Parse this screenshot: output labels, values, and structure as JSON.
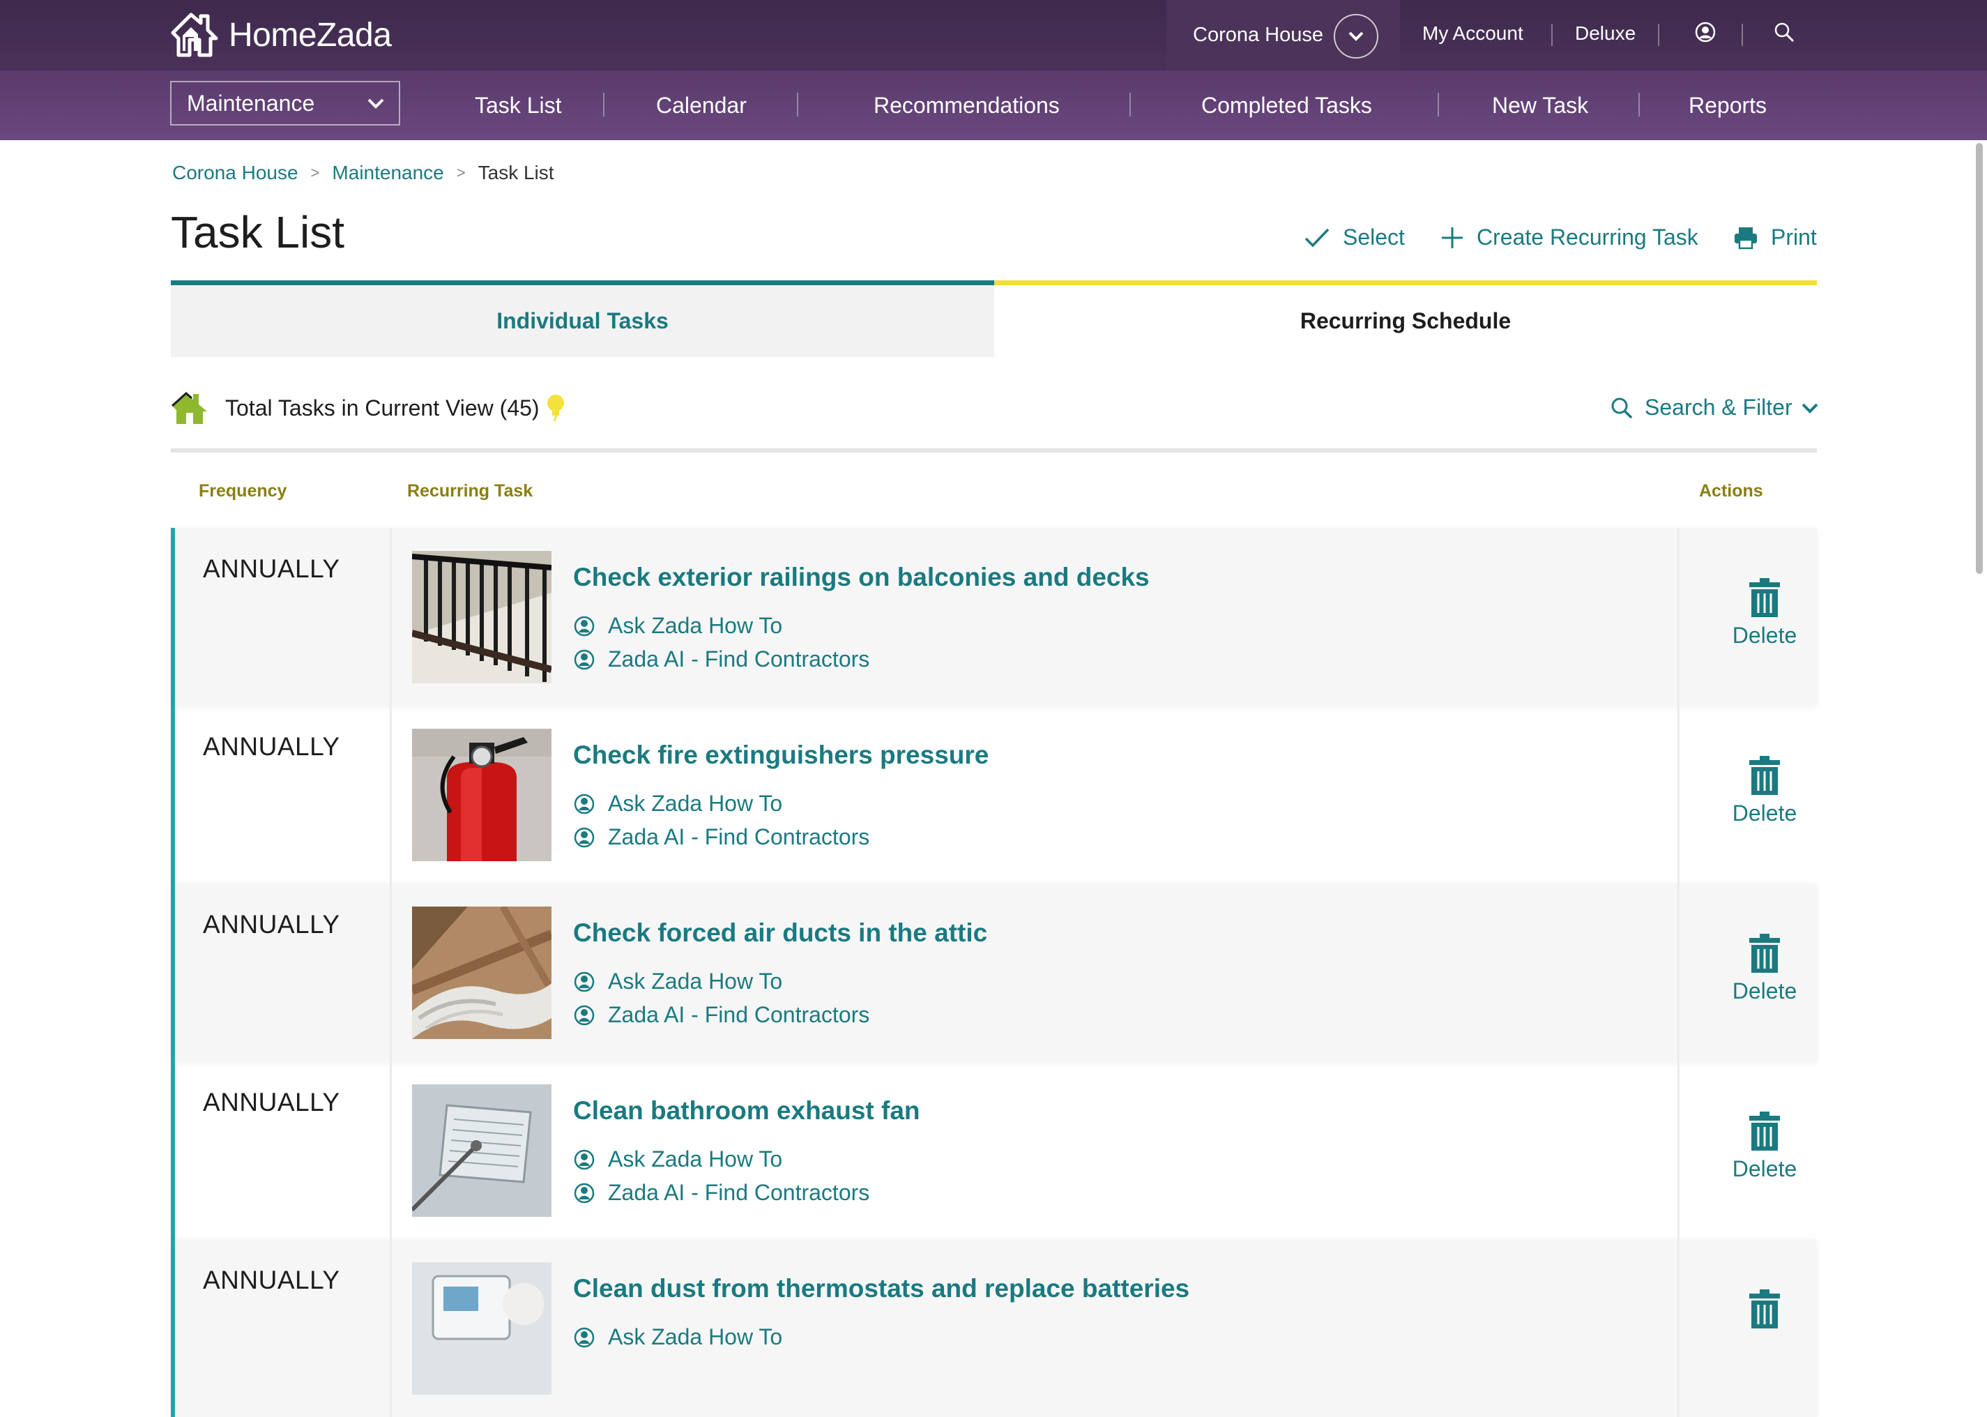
{
  "brand": {
    "name": "HomeZada"
  },
  "header": {
    "house": "Corona House",
    "my_account": "My Account",
    "plan": "Deluxe"
  },
  "nav": {
    "module": "Maintenance",
    "items": [
      {
        "label": "Task List"
      },
      {
        "label": "Calendar"
      },
      {
        "label": "Recommendations"
      },
      {
        "label": "Completed Tasks"
      },
      {
        "label": "New Task"
      },
      {
        "label": "Reports"
      }
    ]
  },
  "breadcrumb": [
    "Corona House",
    "Maintenance",
    "Task List"
  ],
  "page": {
    "title": "Task List",
    "actions": {
      "select": "Select",
      "create": "Create Recurring Task",
      "print": "Print"
    }
  },
  "tabs": {
    "individual": "Individual Tasks",
    "recurring": "Recurring Schedule"
  },
  "summary": {
    "total_text": "Total Tasks in Current View (45)",
    "search_filter": "Search & Filter"
  },
  "table": {
    "headers": {
      "frequency": "Frequency",
      "task": "Recurring Task",
      "actions": "Actions"
    },
    "link_ask": "Ask Zada How To",
    "link_contractors": "Zada AI - Find Contractors",
    "delete_label": "Delete",
    "rows": [
      {
        "frequency": "ANNUALLY",
        "title": "Check exterior railings on balconies and decks",
        "image": "railing-photo"
      },
      {
        "frequency": "ANNUALLY",
        "title": "Check fire extinguishers pressure",
        "image": "fire-extinguisher-photo"
      },
      {
        "frequency": "ANNUALLY",
        "title": "Check forced air ducts in the attic",
        "image": "attic-duct-photo"
      },
      {
        "frequency": "ANNUALLY",
        "title": "Clean bathroom exhaust fan",
        "image": "exhaust-fan-photo"
      },
      {
        "frequency": "ANNUALLY",
        "title": "Clean dust from thermostats and replace batteries",
        "image": "thermostat-photo"
      }
    ]
  },
  "colors": {
    "teal": "#1a7a80",
    "purple": "#4a3159",
    "yellow": "#f0de3a",
    "olive": "#8a7f12"
  }
}
